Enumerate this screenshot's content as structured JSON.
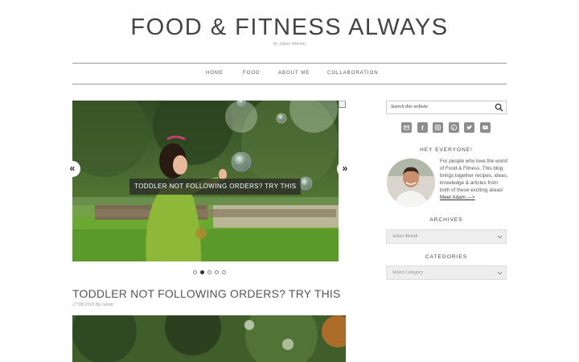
{
  "header": {
    "title": "FOOD & FITNESS ALWAYS",
    "byline": "by Adam Warren"
  },
  "nav": {
    "items": [
      {
        "label": "HOME"
      },
      {
        "label": "FOOD"
      },
      {
        "label": "ABOUT ME"
      },
      {
        "label": "COLLABORATION"
      }
    ]
  },
  "slider": {
    "caption": "TODDLER NOT FOLLOWING ORDERS? TRY THIS",
    "prev_label": "«",
    "next_label": "»",
    "dot_count": 5,
    "active_dot": 1
  },
  "post": {
    "title": "TODDLER NOT FOLLOWING ORDERS? TRY THIS",
    "meta": "27/06/2016 By Adam"
  },
  "sidebar": {
    "search_placeholder": "Search this website",
    "social_icons": [
      "email-icon",
      "facebook-icon",
      "instagram-icon",
      "pinterest-icon",
      "twitter-icon",
      "youtube-icon"
    ],
    "about": {
      "title": "HEY EVERYONE!",
      "text": "For people who love the world of Food & Fitness. This blog brings together recipes, ideas, knowledge & articles from both of these exciting areas! ",
      "link": "Meet Adam --->"
    },
    "archives": {
      "title": "ARCHIVES",
      "selected": "Select Month"
    },
    "categories": {
      "title": "CATEGORIES",
      "selected": "Select Category"
    }
  },
  "colors": {
    "social_bg": "#8d8d8d",
    "caption_bg": "#282828",
    "grass": "#6aa832",
    "coat": "#8db838"
  }
}
